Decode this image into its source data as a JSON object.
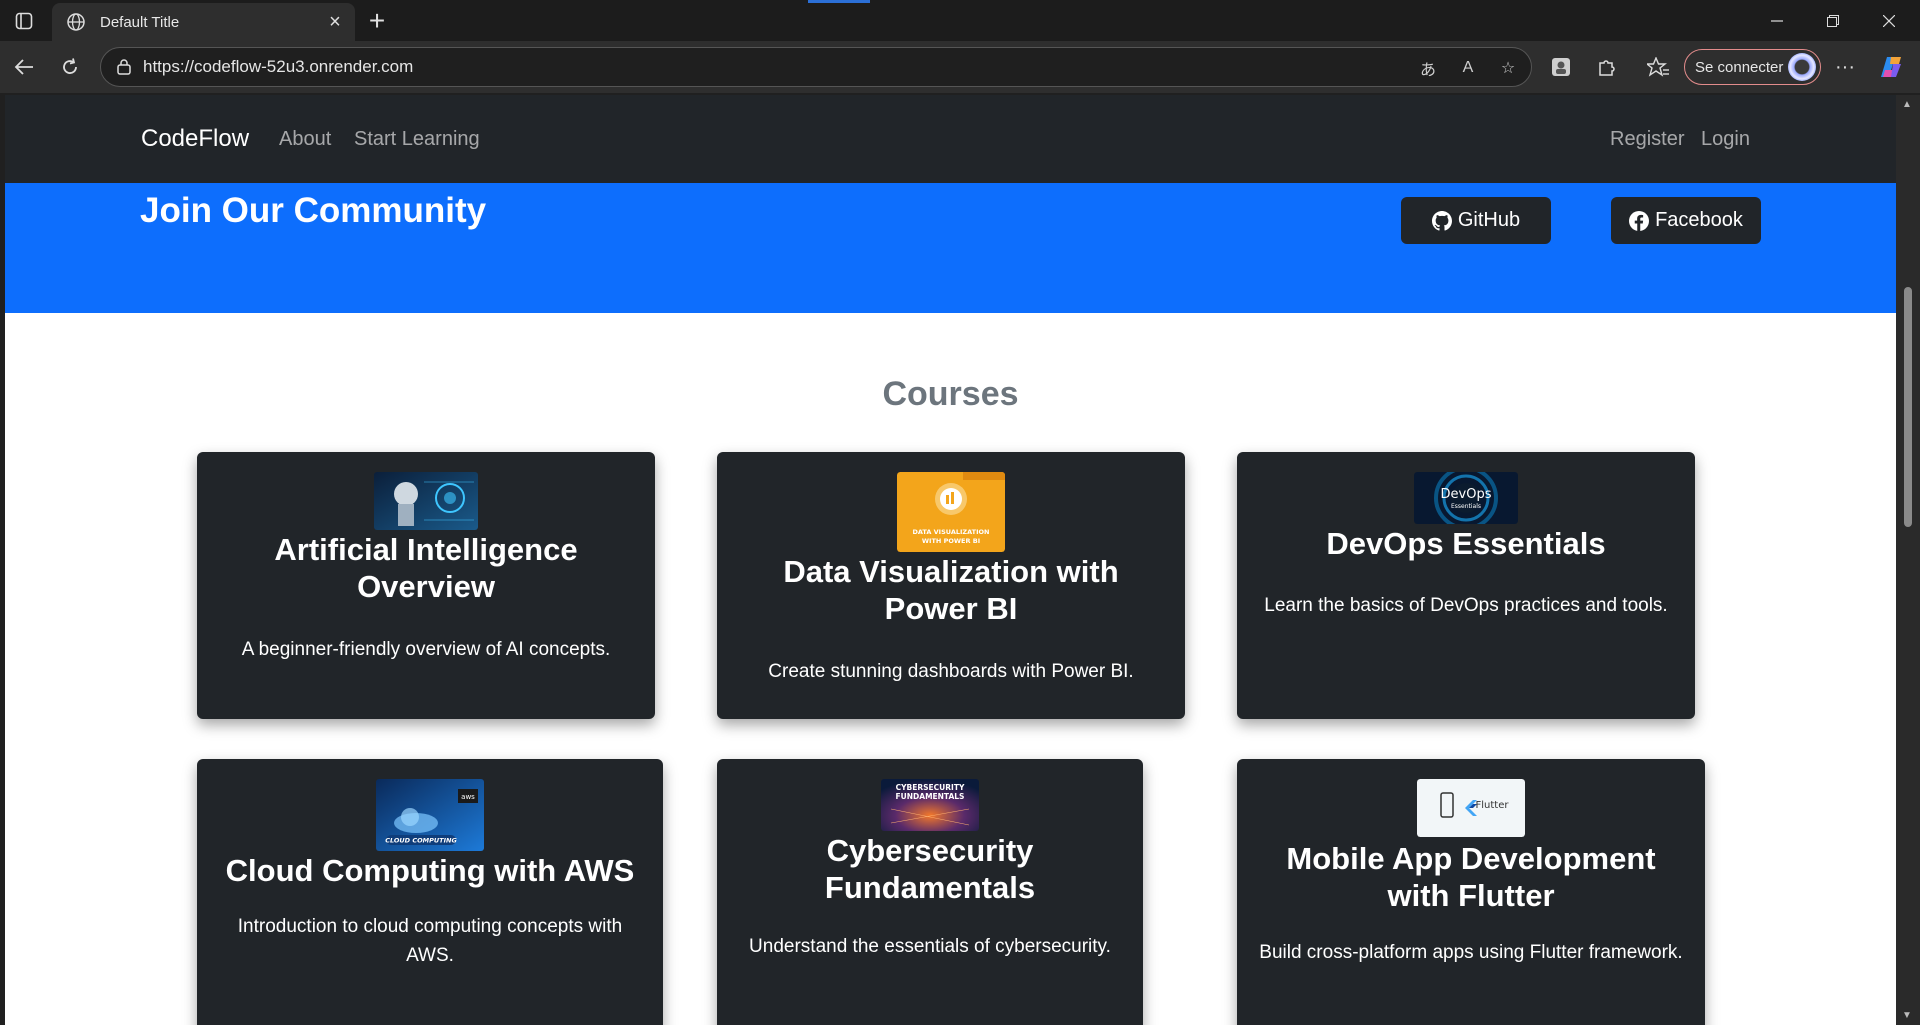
{
  "browser": {
    "tab_title": "Default Title",
    "url": "https://codeflow-52u3.onrender.com",
    "sign_in_label": "Se connecter"
  },
  "navbar": {
    "brand": "CodeFlow",
    "links": [
      "About",
      "Start Learning"
    ],
    "right_links": [
      "Register",
      "Login"
    ]
  },
  "community": {
    "title": "Join Our Community",
    "github_label": "GitHub",
    "facebook_label": "Facebook"
  },
  "courses": {
    "heading": "Courses",
    "items": [
      {
        "title": "Artificial Intelligence Overview",
        "description": "A beginner-friendly overview of AI concepts.",
        "image": "ai-robot-thumbnail"
      },
      {
        "title": "Data Visualization with Power BI",
        "description": "Create stunning dashboards with Power BI.",
        "image": "power-bi-thumbnail",
        "image_text": "DATA VISUALIZATION WITH POWER BI"
      },
      {
        "title": "DevOps Essentials",
        "description": "Learn the basics of DevOps practices and tools.",
        "image": "devops-thumbnail",
        "image_text": "DevOps",
        "image_subtext": "Essentials"
      },
      {
        "title": "Cloud Computing with AWS",
        "description": "Introduction to cloud computing concepts with AWS.",
        "image": "aws-cloud-thumbnail",
        "image_text": "CLOUD COMPUTING",
        "image_badge": "aws"
      },
      {
        "title": "Cybersecurity Fundamentals",
        "description": "Understand the essentials of cybersecurity.",
        "image": "cybersecurity-thumbnail",
        "image_text": "CYBERSECURITY FUNDAMENTALS"
      },
      {
        "title": "Mobile App Development with Flutter",
        "description": "Build cross-platform apps using Flutter framework.",
        "image": "flutter-thumbnail",
        "image_text": "Flutter"
      }
    ]
  },
  "colors": {
    "navbar_bg": "#212529",
    "community_bg": "#0d6efd",
    "card_bg": "#212529",
    "heading_gray": "#6c757d"
  }
}
